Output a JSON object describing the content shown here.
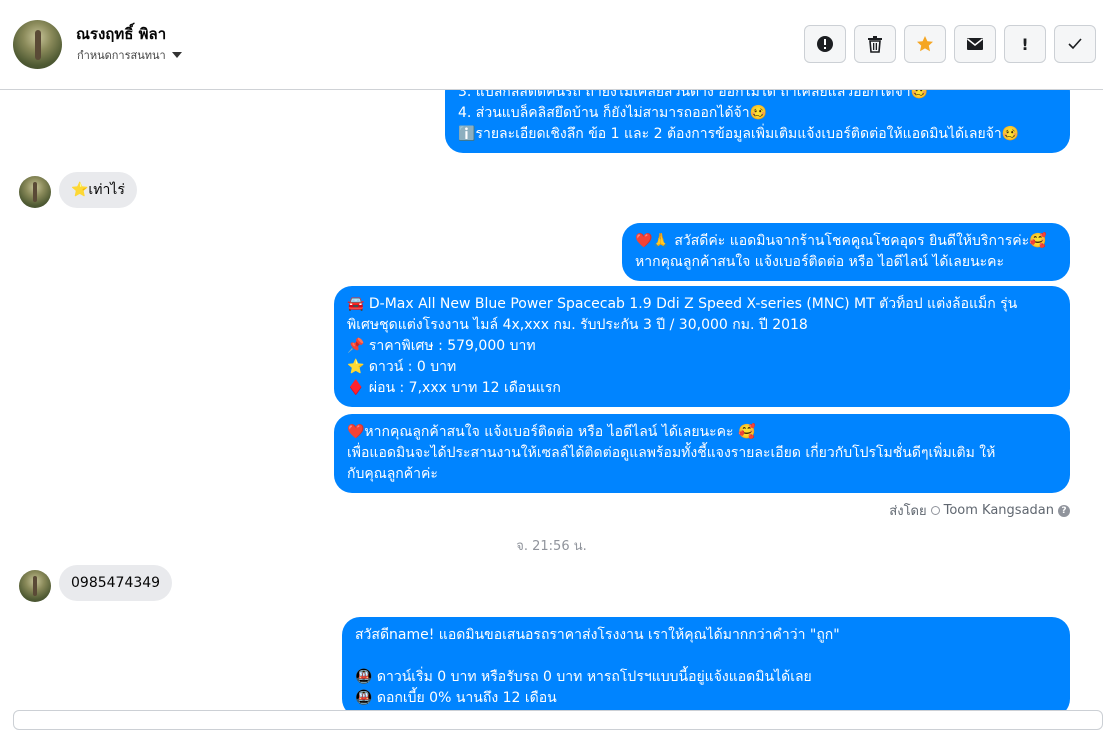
{
  "header": {
    "contact_name": "ณรงฤทธิ์ พิลา",
    "sub_label": "กำหนดการสนทนา",
    "toolbar": [
      {
        "icon": "alert-circle-icon",
        "glyph": "!"
      },
      {
        "icon": "trash-icon",
        "glyph": "🗑"
      },
      {
        "icon": "star-icon",
        "glyph": "★"
      },
      {
        "icon": "envelope-icon",
        "glyph": "✉"
      },
      {
        "icon": "exclamation-icon",
        "glyph": "!"
      },
      {
        "icon": "checkmark-icon",
        "glyph": "✓"
      }
    ]
  },
  "messages": {
    "m1": {
      "line1": "3. แบ่ลกลสติ๊ดคันรถ ถ้ายังไม่เคลียส่วนต่าง ออกไม่ได้ ถ้าเคลียแล้วออกได้จ้า🥴",
      "line2": "4. ส่วนแบล็คลิสยึดบ้าน ก็ยังไม่สามารถออกได้จ้า🥴",
      "line3": "ℹ️รายละเอียดเชิงลึก ข้อ 1 และ 2 ต้องการข้อมูลเพิ่มเติมแจ้งเบอร์ติดต่อให้แอดมินได้เลยจ้า🥴"
    },
    "m2": {
      "text": "⭐เท่าไร่"
    },
    "m3": {
      "line1": "❤️🙏 สวัสดีค่ะ แอดมินจากร้านโชคคูณโชคอุดร ยินดีให้บริการค่ะ🥰",
      "line2": "หากคุณลูกค้าสนใจ แจ้งเบอร์ติดต่อ หรือ ไอดีไลน์ ได้เลยนะคะ"
    },
    "m4": {
      "line1": "🚘 D-Max All New Blue Power Spacecab 1.9 Ddi Z Speed X-series (MNC) MT ตัวท็อป แต่งล้อแม็ก รุ่น",
      "line2": "พิเศษชุดแต่งโรงงาน ไมล์ 4x,xxx กม. รับประกัน 3 ปี / 30,000 กม. ปี 2018",
      "line3": "📌 ราคาพิเศษ : 579,000 บาท",
      "line4": "⭐ ดาวน์ : 0 บาท",
      "line5": "♦️ ผ่อน : 7,xxx บาท 12 เดือนแรก"
    },
    "m5": {
      "line1": "❤️หากคุณลูกค้าสนใจ แจ้งเบอร์ติดต่อ หรือ ไอดีไลน์ ได้เลยนะคะ 🥰",
      "line2": "เพื่อแอดมินจะได้ประสานงานให้เซลล์ได้ติดต่อดูแลพร้อมทั้งชี้แจงรายละเอียด เกี่ยวกับโปรโมชั่นดีๆเพิ่มเติม ให้",
      "line3": "กับคุณลูกค้าค่ะ"
    },
    "sent_by_label": "ส่งโดย",
    "sent_by_name": "Toom Kangsadan",
    "timestamp": "จ. 21:56 น.",
    "m6": {
      "text": "0985474349"
    },
    "m7": {
      "line1": "สวัสดีname! แอดมินขอเสนอรถราคาส่งโรงงาน เราให้คุณได้มากกว่าคำว่า \"ถูก\"",
      "line2": "🚇 ดาวน์เริ่ม 0 บาท หรือรับรถ 0 บาท หารถโปรฯแบบนี้อยู่แจ้งแอดมินได้เลย",
      "line3": "🚇 ดอกเบี้ย 0% นานถึง 12 เดือน"
    }
  }
}
